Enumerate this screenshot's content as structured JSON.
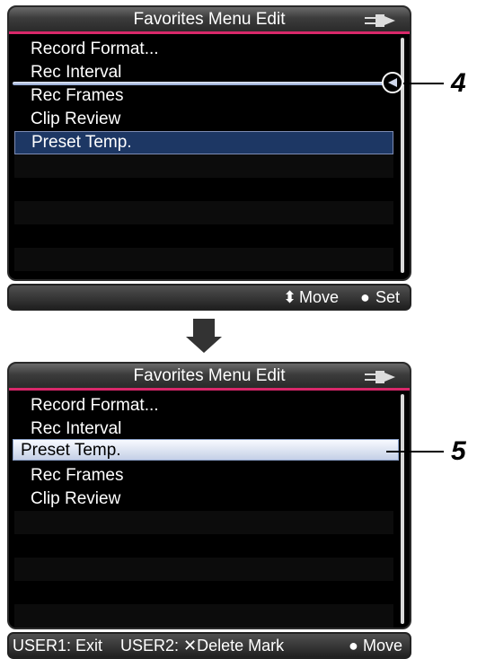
{
  "panel1": {
    "title": "Favorites Menu Edit",
    "items": [
      "Record Format...",
      "Rec Interval",
      "Rec Frames",
      "Clip Review",
      "Preset Temp."
    ],
    "callout": "4",
    "bottom": {
      "move_label": "Move",
      "set_label": "Set"
    }
  },
  "panel2": {
    "title": "Favorites Menu Edit",
    "items": [
      "Record Format...",
      "Rec Interval",
      "Preset Temp.",
      "Rec Frames",
      "Clip Review"
    ],
    "callout": "5",
    "bottom": {
      "user1": "USER1: Exit",
      "user2": "USER2: ✕Delete Mark",
      "move_label": "Move"
    }
  },
  "icons": {
    "power": "power-plug-icon",
    "move": "up-down-arrows-icon",
    "set": "dot-icon",
    "transition": "down-arrow-icon"
  },
  "colors": {
    "title_accent": "#d8286a",
    "selection": "#1d3764",
    "screen_bg": "#000000"
  }
}
